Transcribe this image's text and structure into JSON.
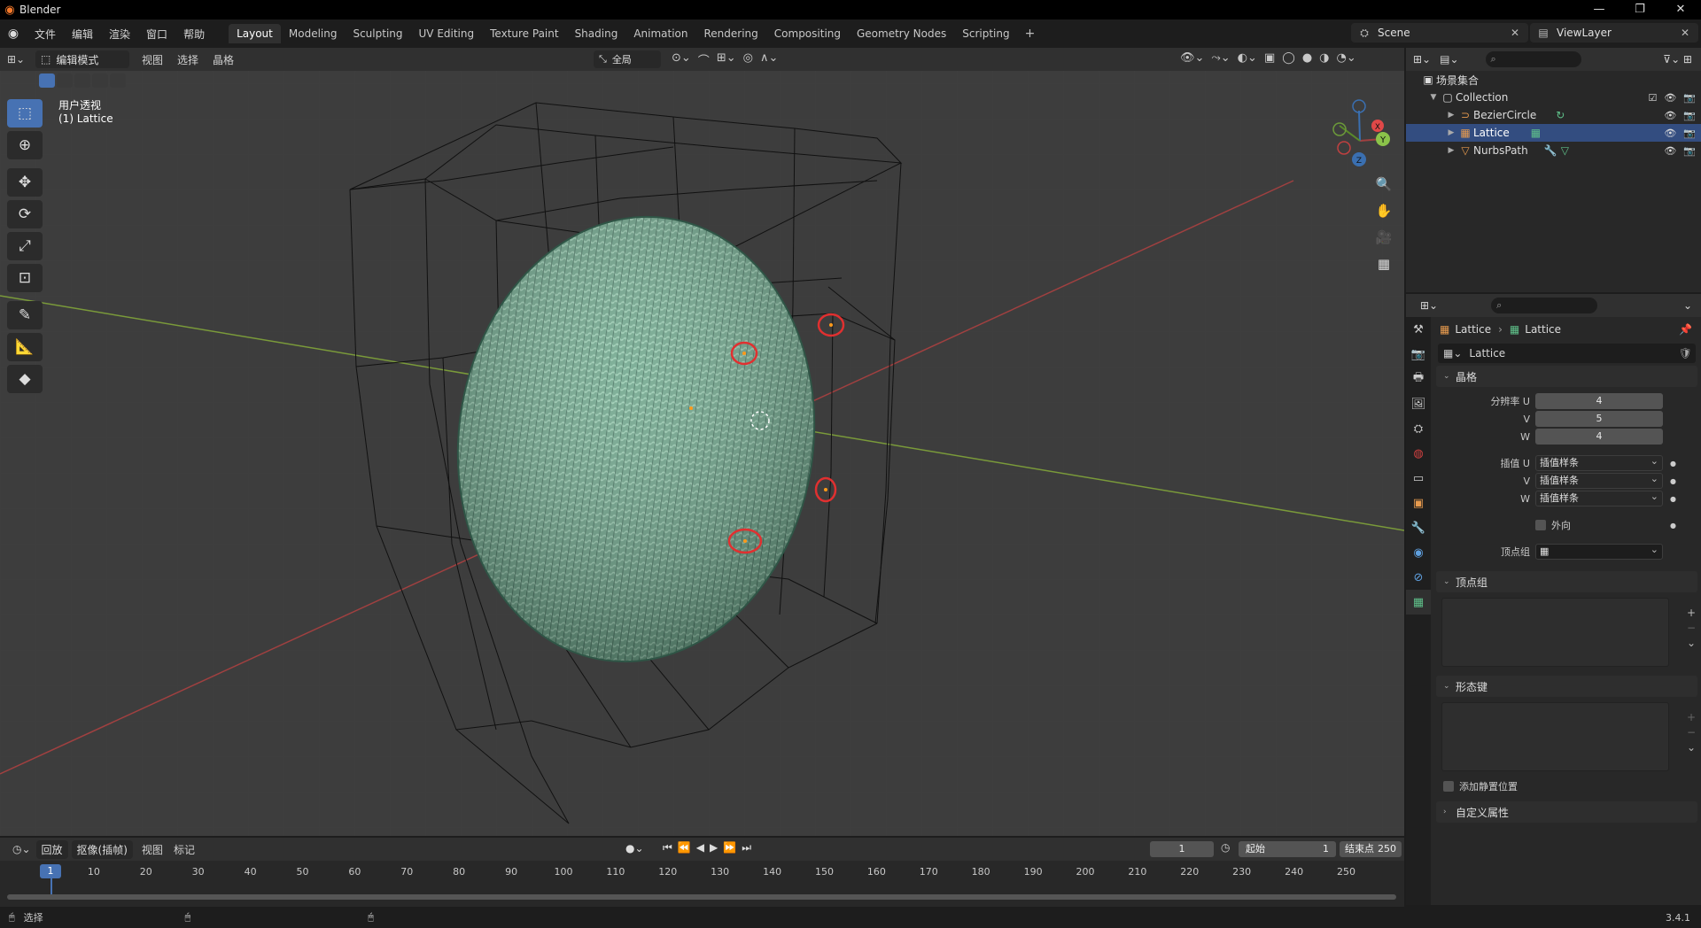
{
  "window": {
    "title": "Blender"
  },
  "menubar": {
    "menus": [
      "文件",
      "编辑",
      "渲染",
      "窗口",
      "帮助"
    ],
    "workspaces": [
      "Layout",
      "Modeling",
      "Sculpting",
      "UV Editing",
      "Texture Paint",
      "Shading",
      "Animation",
      "Rendering",
      "Compositing",
      "Geometry Nodes",
      "Scripting"
    ],
    "active_workspace": "Layout",
    "scene": "Scene",
    "view_layer": "ViewLayer"
  },
  "viewport": {
    "mode": "编辑模式",
    "menus": [
      "视图",
      "选择",
      "晶格"
    ],
    "transform_orientation": "全局",
    "overlay_title": "用户透视",
    "overlay_object": "(1) Lattice",
    "gizmo": {
      "x": "X",
      "y": "Y",
      "z": "Z"
    }
  },
  "outliner": {
    "root": "场景集合",
    "collection": "Collection",
    "items": [
      {
        "name": "BezierCircle",
        "icon_color": "#e69a4e",
        "selected": false
      },
      {
        "name": "Lattice",
        "icon_color": "#e69a4e",
        "selected": true
      },
      {
        "name": "NurbsPath",
        "icon_color": "#e69a4e",
        "selected": false
      }
    ]
  },
  "properties": {
    "breadcrumb_object": "Lattice",
    "breadcrumb_data": "Lattice",
    "datablock_name": "Lattice",
    "lattice_panel": "晶格",
    "resolution_label_u": "分辨率 U",
    "label_v": "V",
    "label_w": "W",
    "resolution": {
      "u": "4",
      "v": "5",
      "w": "4"
    },
    "interp_label_u": "插值 U",
    "interpolation": {
      "u": "插值样条",
      "v": "插值样条",
      "w": "插值样条"
    },
    "outside_label": "外向",
    "vertex_group_label": "顶点组",
    "vertex_groups_panel": "顶点组",
    "shape_keys_panel": "形态键",
    "relative_label": "添加静置位置",
    "custom_props_panel": "自定义属性"
  },
  "timeline": {
    "menus": [
      "回放",
      "抠像(插帧)",
      "视图",
      "标记"
    ],
    "current_frame": "1",
    "start_label": "起始",
    "start": "1",
    "end_label": "结束点",
    "end": "250",
    "ticks": [
      "10",
      "20",
      "30",
      "40",
      "50",
      "60",
      "70",
      "80",
      "90",
      "100",
      "110",
      "120",
      "130",
      "140",
      "150",
      "160",
      "170",
      "180",
      "190",
      "200",
      "210",
      "220",
      "230",
      "240",
      "250"
    ]
  },
  "statusbar": {
    "select_label": "选择",
    "version": "3.4.1"
  }
}
